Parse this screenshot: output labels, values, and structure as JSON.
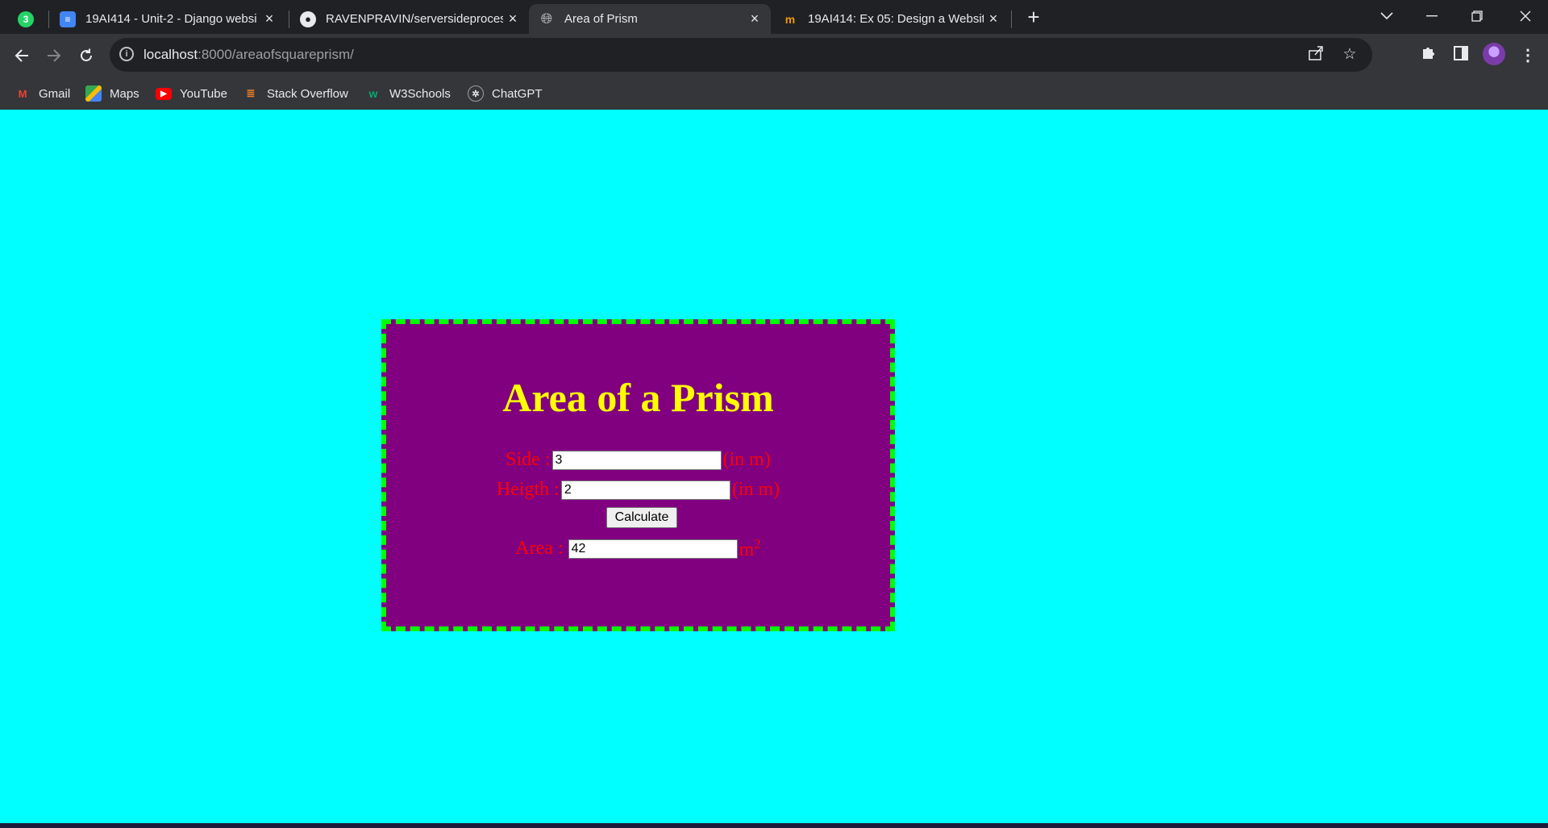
{
  "tabs": [
    {
      "title": "",
      "badge": "3",
      "active": false
    },
    {
      "title": "19AI414 - Unit-2 - Django websi",
      "active": false
    },
    {
      "title": "RAVENPRAVIN/serversideproces",
      "active": false
    },
    {
      "title": "Area of Prism",
      "active": true
    },
    {
      "title": "19AI414: Ex 05: Design a Websit",
      "active": false
    }
  ],
  "address": {
    "host": "localhost",
    "path": ":8000/areaofsquareprism/"
  },
  "bookmarks": [
    {
      "label": "Gmail",
      "icon": "gmail-icon"
    },
    {
      "label": "Maps",
      "icon": "maps-icon"
    },
    {
      "label": "YouTube",
      "icon": "youtube-icon"
    },
    {
      "label": "Stack Overflow",
      "icon": "stackoverflow-icon"
    },
    {
      "label": "W3Schools",
      "icon": "w3schools-icon"
    },
    {
      "label": "ChatGPT",
      "icon": "chatgpt-icon"
    }
  ],
  "page": {
    "heading": "Area of a Prism",
    "side_label": "Side :",
    "side_value": "3",
    "side_unit": "(in m)",
    "height_label": "Heigth :",
    "height_value": "2",
    "height_unit": "(in m)",
    "button_label": "Calculate",
    "area_label": "Area :",
    "area_value": "42",
    "area_unit": "m",
    "area_unit_power": "2"
  },
  "colors": {
    "page_background": "#00ffff",
    "card_background": "#800080",
    "card_border": "#00ff00",
    "heading": "#ffff00",
    "labels": "#ff0000"
  }
}
